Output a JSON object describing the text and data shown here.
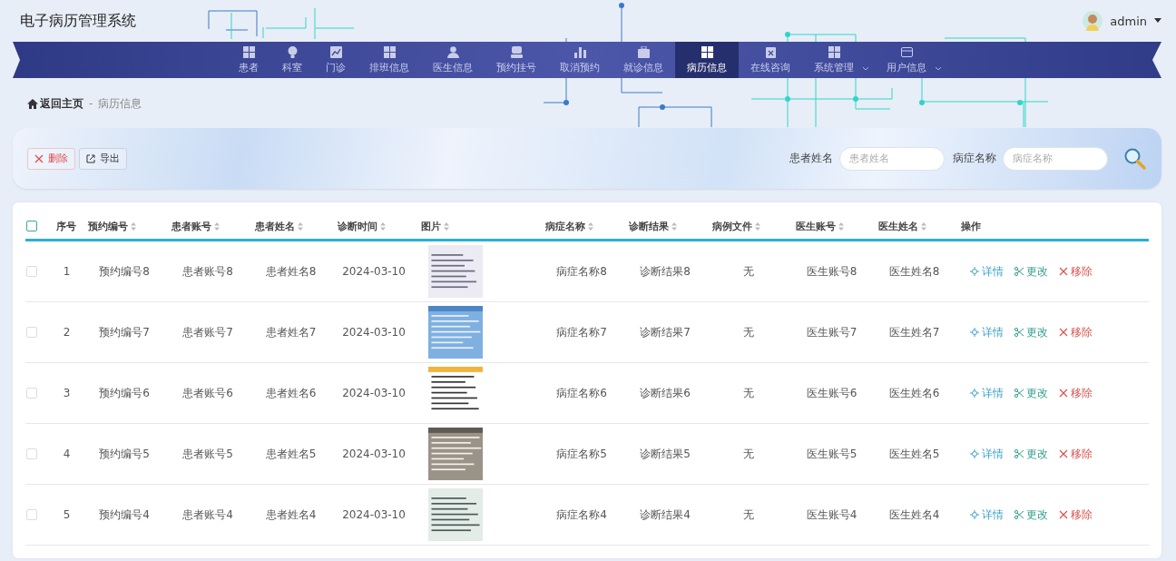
{
  "app": {
    "title": "电子病历管理系统",
    "user": "admin"
  },
  "nav": [
    {
      "label": "患者",
      "selected": false,
      "has_menu": false
    },
    {
      "label": "科室",
      "selected": false,
      "has_menu": false
    },
    {
      "label": "门诊",
      "selected": false,
      "has_menu": false
    },
    {
      "label": "排班信息",
      "selected": false,
      "has_menu": false
    },
    {
      "label": "医生信息",
      "selected": false,
      "has_menu": false
    },
    {
      "label": "预约挂号",
      "selected": false,
      "has_menu": false
    },
    {
      "label": "取消预约",
      "selected": false,
      "has_menu": false
    },
    {
      "label": "就诊信息",
      "selected": false,
      "has_menu": false
    },
    {
      "label": "病历信息",
      "selected": true,
      "has_menu": false
    },
    {
      "label": "在线咨询",
      "selected": false,
      "has_menu": false
    },
    {
      "label": "系统管理",
      "selected": false,
      "has_menu": true
    },
    {
      "label": "用户信息",
      "selected": false,
      "has_menu": true
    }
  ],
  "breadcrumb": {
    "home": "返回主页",
    "separator": "-",
    "current": "病历信息"
  },
  "toolbar": {
    "buttons": [
      {
        "label": "删除",
        "kind": "danger"
      },
      {
        "label": "导出",
        "kind": "export"
      }
    ],
    "filters": [
      {
        "label": "患者姓名",
        "placeholder": "患者姓名"
      },
      {
        "label": "病症名称",
        "placeholder": "病症名称"
      }
    ]
  },
  "table": {
    "select_all": {
      "checked": false
    },
    "columns": [
      {
        "label": "序号",
        "sortable": false
      },
      {
        "label": "预约编号",
        "sortable": true
      },
      {
        "label": "患者账号",
        "sortable": true
      },
      {
        "label": "患者姓名",
        "sortable": true
      },
      {
        "label": "诊断时间",
        "sortable": true
      },
      {
        "label": "图片",
        "sortable": true
      },
      {
        "label": "病症名称",
        "sortable": true
      },
      {
        "label": "诊断结果",
        "sortable": true
      },
      {
        "label": "病例文件",
        "sortable": true
      },
      {
        "label": "医生账号",
        "sortable": true
      },
      {
        "label": "医生姓名",
        "sortable": true
      },
      {
        "label": "操作",
        "sortable": false
      }
    ],
    "rows": [
      {
        "selected": false,
        "cells": [
          "1",
          "预约编号8",
          "患者账号8",
          "患者姓名8",
          "2024-03-10"
        ],
        "rest": [
          "病症名称8",
          "诊断结果8",
          "无",
          "医生账号8",
          "医生姓名8"
        ],
        "actions": [
          {
            "label": "详情",
            "kind": "view"
          },
          {
            "label": "更改",
            "kind": "edit"
          },
          {
            "label": "移除",
            "kind": "remove"
          }
        ]
      },
      {
        "selected": false,
        "cells": [
          "2",
          "预约编号7",
          "患者账号7",
          "患者姓名7",
          "2024-03-10"
        ],
        "rest": [
          "病症名称7",
          "诊断结果7",
          "无",
          "医生账号7",
          "医生姓名7"
        ],
        "actions": [
          {
            "label": "详情",
            "kind": "view"
          },
          {
            "label": "更改",
            "kind": "edit"
          },
          {
            "label": "移除",
            "kind": "remove"
          }
        ]
      },
      {
        "selected": false,
        "cells": [
          "3",
          "预约编号6",
          "患者账号6",
          "患者姓名6",
          "2024-03-10"
        ],
        "rest": [
          "病症名称6",
          "诊断结果6",
          "无",
          "医生账号6",
          "医生姓名6"
        ],
        "actions": [
          {
            "label": "详情",
            "kind": "view"
          },
          {
            "label": "更改",
            "kind": "edit"
          },
          {
            "label": "移除",
            "kind": "remove"
          }
        ]
      },
      {
        "selected": false,
        "cells": [
          "4",
          "预约编号5",
          "患者账号5",
          "患者姓名5",
          "2024-03-10"
        ],
        "rest": [
          "病症名称5",
          "诊断结果5",
          "无",
          "医生账号5",
          "医生姓名5"
        ],
        "actions": [
          {
            "label": "详情",
            "kind": "view"
          },
          {
            "label": "更改",
            "kind": "edit"
          },
          {
            "label": "移除",
            "kind": "remove"
          }
        ]
      },
      {
        "selected": false,
        "cells": [
          "5",
          "预约编号4",
          "患者账号4",
          "患者姓名4",
          "2024-03-10"
        ],
        "rest": [
          "病症名称4",
          "诊断结果4",
          "无",
          "医生账号4",
          "医生姓名4"
        ],
        "actions": [
          {
            "label": "详情",
            "kind": "view"
          },
          {
            "label": "更改",
            "kind": "edit"
          },
          {
            "label": "移除",
            "kind": "remove"
          }
        ]
      }
    ]
  }
}
